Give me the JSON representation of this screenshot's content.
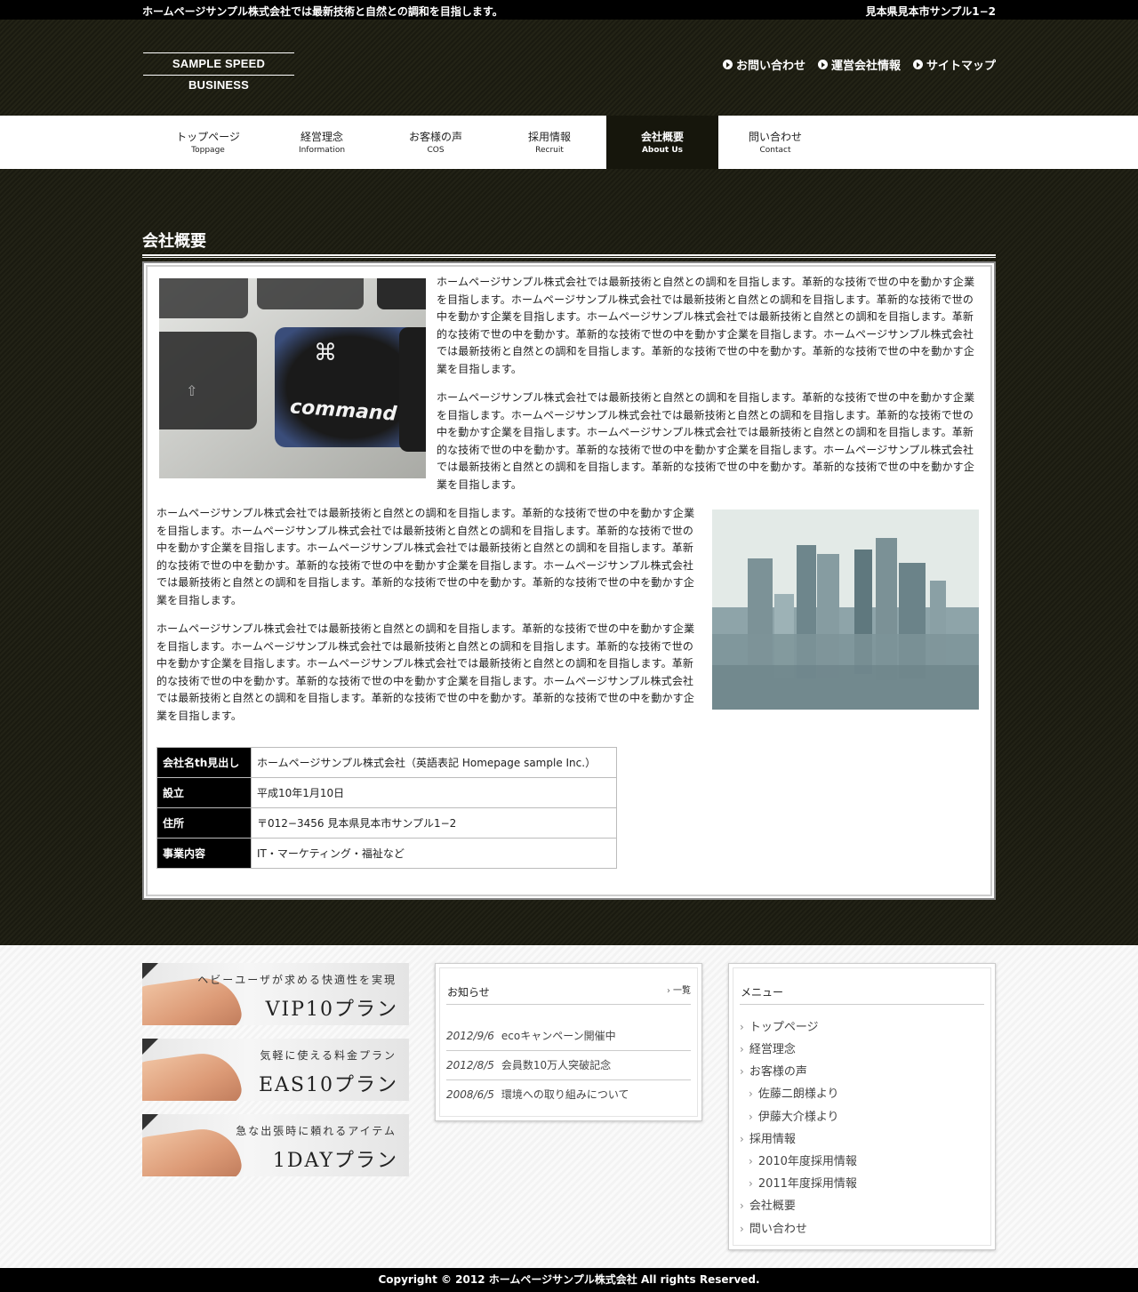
{
  "topbar": {
    "tagline": "ホームページサンプル株式会社では最新技術と自然との調和を目指します。",
    "address": "見本県見本市サンプル1−2"
  },
  "header": {
    "logo": "SAMPLE SPEED BUSINESS",
    "links": [
      "お問い合わせ",
      "運営会社情報",
      "サイトマップ"
    ]
  },
  "nav": {
    "items": [
      {
        "jp": "トップページ",
        "en": "Toppage"
      },
      {
        "jp": "経営理念",
        "en": "Information"
      },
      {
        "jp": "お客様の声",
        "en": "COS"
      },
      {
        "jp": "採用情報",
        "en": "Recruit"
      },
      {
        "jp": "会社概要",
        "en": "About Us"
      },
      {
        "jp": "問い合わせ",
        "en": "Contact"
      }
    ],
    "active": 4
  },
  "main": {
    "title": "会社概要",
    "paragraph": "ホームページサンプル株式会社では最新技術と自然との調和を目指します。革新的な技術で世の中を動かす企業を目指します。ホームページサンプル株式会社では最新技術と自然との調和を目指します。革新的な技術で世の中を動かす企業を目指します。ホームページサンプル株式会社では最新技術と自然との調和を目指します。革新的な技術で世の中を動かす。革新的な技術で世の中を動かす企業を目指します。ホームページサンプル株式会社では最新技術と自然との調和を目指します。革新的な技術で世の中を動かす。革新的な技術で世の中を動かす企業を目指します。",
    "keyboard_key": "command",
    "table": [
      {
        "th": "会社名th見出し",
        "td": "ホームページサンプル株式会社（英語表記 Homepage sample Inc.）"
      },
      {
        "th": "設立",
        "td": "平成10年1月10日"
      },
      {
        "th": "住所",
        "td": "〒012−3456 見本県見本市サンプル1−2"
      },
      {
        "th": "事業内容",
        "td": "IT・マーケティング・福祉など"
      }
    ]
  },
  "banners": [
    {
      "sub": "ヘビーユーザが求める快適性を実現",
      "main": "VIP10プラン"
    },
    {
      "sub": "気軽に使える料金プラン",
      "main": "EAS10プラン"
    },
    {
      "sub": "急な出張時に頼れるアイテム",
      "main": "1DAYプラン"
    }
  ],
  "news": {
    "title": "お知らせ",
    "more": "一覧",
    "items": [
      {
        "date": "2012/9/6",
        "text": "ecoキャンペーン開催中"
      },
      {
        "date": "2012/8/5",
        "text": "会員数10万人突破記念"
      },
      {
        "date": "2008/6/5",
        "text": "環境への取り組みについて"
      }
    ]
  },
  "menu": {
    "title": "メニュー",
    "items": [
      {
        "label": "トップページ",
        "level": 0
      },
      {
        "label": "経営理念",
        "level": 0
      },
      {
        "label": "お客様の声",
        "level": 0
      },
      {
        "label": "佐藤二朗様より",
        "level": 1
      },
      {
        "label": "伊藤大介様より",
        "level": 1
      },
      {
        "label": "採用情報",
        "level": 0
      },
      {
        "label": "2010年度採用情報",
        "level": 1
      },
      {
        "label": "2011年度採用情報",
        "level": 1
      },
      {
        "label": "会社概要",
        "level": 0
      },
      {
        "label": "問い合わせ",
        "level": 0
      }
    ]
  },
  "footer": {
    "copyright": "Copyright © 2012 ホームページサンプル株式会社 All rights Reserved."
  }
}
